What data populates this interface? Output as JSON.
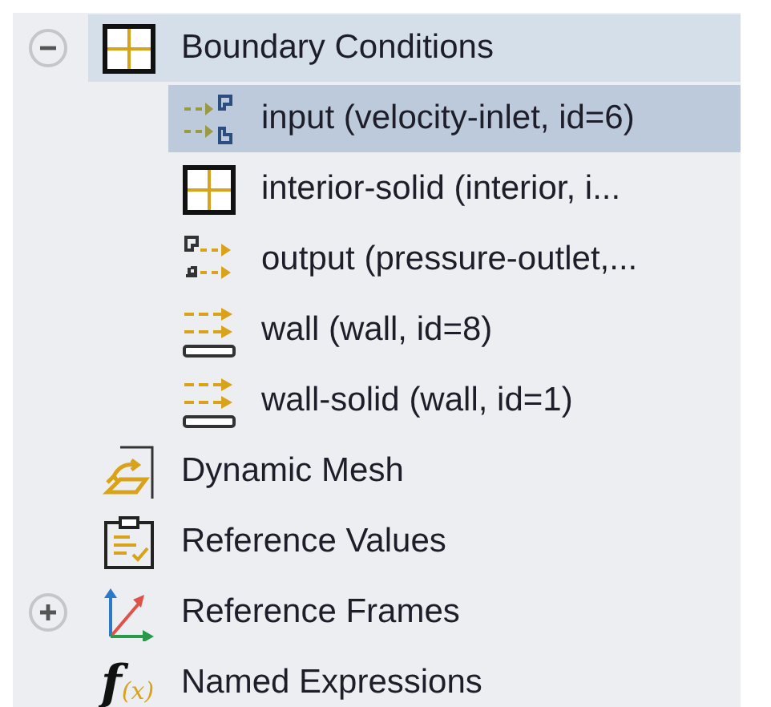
{
  "tree": [
    {
      "label": "Boundary Conditions",
      "kind": "grid",
      "expanded": true,
      "selected": false,
      "highlighted": true,
      "children": [
        {
          "label": "input (velocity-inlet, id=6)",
          "kind": "inlet",
          "selected": true,
          "highlighted": false
        },
        {
          "label": "interior-solid (interior, i...",
          "kind": "grid",
          "selected": false,
          "highlighted": false
        },
        {
          "label": "output (pressure-outlet,...",
          "kind": "outlet",
          "selected": false,
          "highlighted": false
        },
        {
          "label": "wall (wall, id=8)",
          "kind": "wall",
          "selected": false,
          "highlighted": false
        },
        {
          "label": "wall-solid (wall, id=1)",
          "kind": "wall",
          "selected": false,
          "highlighted": false
        }
      ]
    },
    {
      "label": "Dynamic Mesh",
      "kind": "mesh",
      "selected": false,
      "highlighted": false
    },
    {
      "label": "Reference Values",
      "kind": "clipboard",
      "selected": false,
      "highlighted": false
    },
    {
      "label": "Reference Frames",
      "kind": "axes",
      "expanded": false,
      "selected": false,
      "highlighted": false
    },
    {
      "label": "Named Expressions",
      "kind": "function",
      "icon_text": [
        "f",
        "(x)"
      ],
      "selected": false,
      "highlighted": false
    }
  ]
}
